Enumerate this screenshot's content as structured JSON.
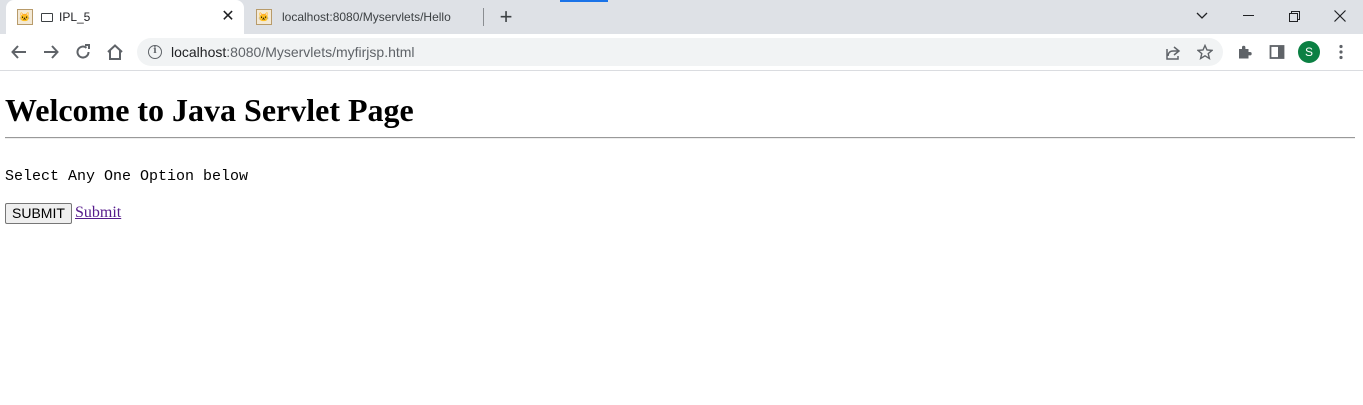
{
  "browser": {
    "tabs": [
      {
        "title": "IPL_5",
        "active": true
      },
      {
        "title": "localhost:8080/Myservlets/Hello",
        "active": false
      }
    ],
    "new_tab_symbol": "+",
    "window_controls": {
      "tab_search": "⌄",
      "minimize": "—",
      "restore": "❐",
      "close": "✕"
    },
    "address": {
      "host": "localhost",
      "path": ":8080/Myservlets/myfirjsp.html"
    },
    "profile_initial": "S",
    "accent_color": "#1a73e8",
    "avatar_color": "#0b8043"
  },
  "page": {
    "heading": "Welcome to Java Servlet Page",
    "instruction": "Select Any One Option below",
    "submit_button_label": "SUBMIT",
    "submit_link_label": "Submit"
  }
}
